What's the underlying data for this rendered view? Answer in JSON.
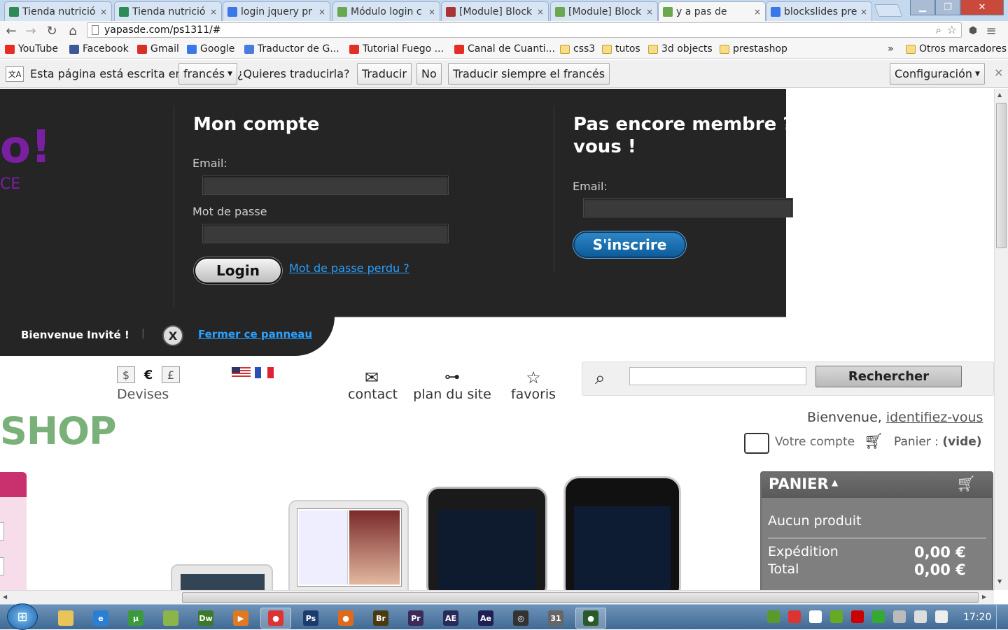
{
  "browser": {
    "tabs": [
      {
        "title": "Tienda nutrició",
        "favicon": "star-icon",
        "color": "#2e8b57"
      },
      {
        "title": "Tienda nutrició",
        "favicon": "star-icon",
        "color": "#2e8b57"
      },
      {
        "title": "login jquery pr",
        "favicon": "google-icon",
        "color": "#3b78e7"
      },
      {
        "title": "Módulo login c",
        "favicon": "prestashop-icon",
        "color": "#6aa84f"
      },
      {
        "title": "[Module] Block",
        "favicon": "prestashop-forum-icon",
        "color": "#a33"
      },
      {
        "title": "[Module] Block",
        "favicon": "prestashop-icon",
        "color": "#6aa84f"
      },
      {
        "title": "y a pas de",
        "favicon": "prestashop-icon",
        "color": "#6aa84f"
      },
      {
        "title": "blockslides pre",
        "favicon": "google-icon",
        "color": "#3b78e7"
      }
    ],
    "tab_close": "×",
    "url": "yapasde.com/ps1311/#",
    "bookmarks": [
      {
        "label": "YouTube",
        "icon": "youtube-icon",
        "color": "#e52d27"
      },
      {
        "label": "Facebook",
        "icon": "facebook-icon",
        "color": "#3b5998"
      },
      {
        "label": "Gmail",
        "icon": "gmail-icon",
        "color": "#d93025"
      },
      {
        "label": "Google",
        "icon": "google-icon",
        "color": "#3b78e7"
      },
      {
        "label": "Traductor de G...",
        "icon": "translate-icon",
        "color": "#4a7be0"
      },
      {
        "label": "Tutorial Fuego ...",
        "icon": "youtube-icon",
        "color": "#e52d27"
      },
      {
        "label": "Canal de Cuanti...",
        "icon": "youtube-icon",
        "color": "#e52d27"
      },
      {
        "label": "css3",
        "icon": "folder-icon"
      },
      {
        "label": "tutos",
        "icon": "folder-icon"
      },
      {
        "label": "3d objects",
        "icon": "folder-icon"
      },
      {
        "label": "prestashop",
        "icon": "folder-icon"
      }
    ],
    "bookmarks_overflow": "»",
    "other_bookmarks": "Otros marcadores",
    "translate": {
      "prefix": "Esta página está escrita en",
      "language": "francés",
      "question": "¿Quieres traducirla?",
      "translate_btn": "Traducir",
      "no_btn": "No",
      "always_btn": "Traducir siempre el francés",
      "settings_btn": "Configuración",
      "close": "×"
    }
  },
  "page": {
    "panel": {
      "logo_text": "o!",
      "logo_sub": "CE",
      "account_title": "Mon compte",
      "email_label": "Email:",
      "password_label": "Mot de passe",
      "login_btn": "Login",
      "forgot_link": "Mot de passe perdu ?",
      "signup_title_1": "Pas encore membre ?",
      "signup_title_2": "vous !",
      "signup_email_label": "Email:",
      "signup_btn": "S'inscrire",
      "welcome": "Bienvenue Invité !",
      "sep": "|",
      "close_x": "X",
      "close_link": "Fermer ce panneau"
    },
    "currencies": [
      "$",
      "€",
      "£"
    ],
    "currency_label": "Devises",
    "nav": [
      {
        "label": "contact",
        "icon": "envelope-icon"
      },
      {
        "label": "plan du site",
        "icon": "sitemap-icon"
      },
      {
        "label": "favoris",
        "icon": "star-icon"
      }
    ],
    "search_btn": "Rechercher",
    "search_value": "",
    "shop_logo": "SHOP",
    "welcome_prefix": "Bienvenue,",
    "login_link": "identifiez-vous",
    "account_link": "Votre compte",
    "cart_label": "Panier :",
    "cart_state": "(vide)",
    "cart": {
      "title": "PANIER",
      "empty": "Aucun produit",
      "shipping_label": "Expédition",
      "shipping_value": "0,00 €",
      "total_label": "Total",
      "total_value": "0,00 €"
    }
  },
  "taskbar": {
    "clock": "17:20",
    "apps": [
      {
        "name": "explorer",
        "icon": "folder-icon",
        "color": "#e8c45a",
        "label": ""
      },
      {
        "name": "ie",
        "icon": "ie-icon",
        "color": "#2a7fd4",
        "label": "e"
      },
      {
        "name": "utorrent",
        "icon": "utorrent-icon",
        "color": "#3c9a3c",
        "label": "µ"
      },
      {
        "name": "notes",
        "icon": "notes-icon",
        "color": "#8bb54a",
        "label": ""
      },
      {
        "name": "dreamweaver",
        "icon": "dreamweaver-icon",
        "color": "#3a7a2a",
        "label": "Dw"
      },
      {
        "name": "media",
        "icon": "media-player-icon",
        "color": "#e07a22",
        "label": "▶"
      },
      {
        "name": "chrome",
        "icon": "chrome-icon",
        "color": "#d33",
        "label": "●"
      },
      {
        "name": "photoshop",
        "icon": "photoshop-icon",
        "color": "#1b3b6e",
        "label": "Ps"
      },
      {
        "name": "firefox",
        "icon": "firefox-icon",
        "color": "#e06a1a",
        "label": "●"
      },
      {
        "name": "bridge",
        "icon": "bridge-icon",
        "color": "#4b3a10",
        "label": "Br"
      },
      {
        "name": "premiere",
        "icon": "premiere-icon",
        "color": "#3d2a5a",
        "label": "Pr"
      },
      {
        "name": "aftereffects",
        "icon": "aftereffects-icon",
        "color": "#2a2a5a",
        "label": "AE"
      },
      {
        "name": "aftereffects2",
        "icon": "aftereffects-icon",
        "color": "#1f1f55",
        "label": "Ae"
      },
      {
        "name": "app",
        "icon": "app-icon",
        "color": "#333",
        "label": "◎"
      },
      {
        "name": "calendar",
        "icon": "calendar-icon",
        "color": "#666",
        "label": "31"
      },
      {
        "name": "ext",
        "icon": "app-icon",
        "color": "#2a5a2a",
        "label": "●"
      }
    ]
  }
}
